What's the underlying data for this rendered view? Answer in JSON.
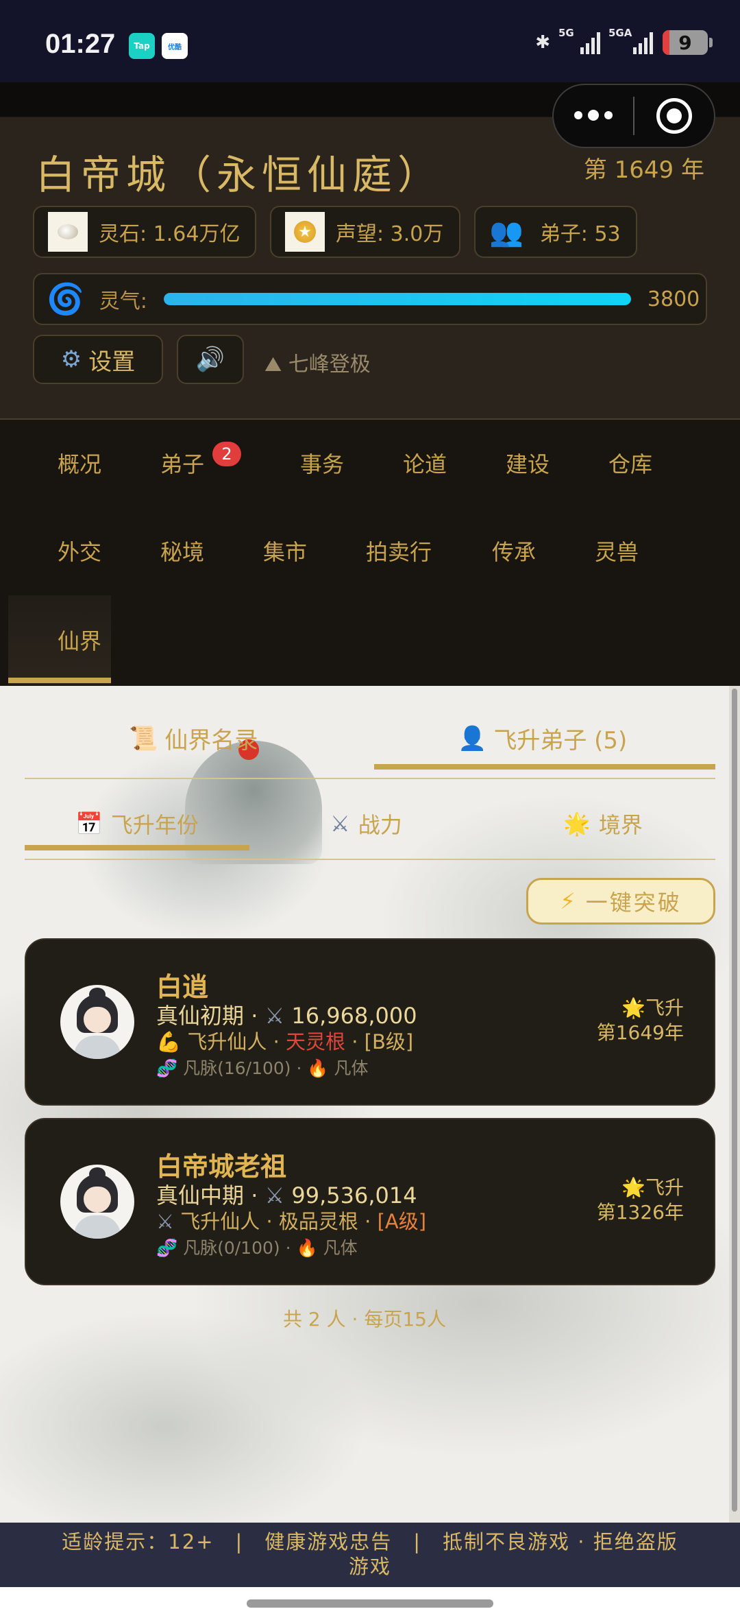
{
  "status_bar": {
    "time": "01:27",
    "apps": [
      "Tap",
      "优酷"
    ],
    "network_1": "5G",
    "network_2": "5GA",
    "battery": "9"
  },
  "header": {
    "sect_title": "白帝城（永恒仙庭）",
    "year": "第 1649 年",
    "spirit_stone": "灵石: 1.64万亿",
    "reputation": "声望: 3.0万",
    "disciples": "弟子: 53",
    "qi_label": "灵气:",
    "qi_value": "3800",
    "qi_fill_fraction": 1.0,
    "settings_label": "设置",
    "settings_icon": "gear-icon",
    "sound_icon": "speaker-icon",
    "peak_text": "七峰登极",
    "peak_icon": "mountain-icon"
  },
  "nav": {
    "items": [
      "概况",
      "弟子",
      "事务",
      "论道",
      "建设",
      "仓库",
      "外交",
      "秘境",
      "集市",
      "拍卖行",
      "传承",
      "灵兽",
      "仙界"
    ],
    "disciple_badge": "2",
    "active": "仙界"
  },
  "tabs": {
    "primary": [
      {
        "label": "仙界名录",
        "icon": "scroll-icon"
      },
      {
        "label": "飞升弟子 (5)",
        "icon": "person-icon",
        "active": true
      }
    ],
    "secondary": [
      {
        "label": "飞升年份",
        "icon": "calendar-icon",
        "active": true
      },
      {
        "label": "战力",
        "icon": "swords-icon"
      },
      {
        "label": "境界",
        "icon": "star-icon"
      }
    ]
  },
  "actions": {
    "breakthrough": "一键突破",
    "breakthrough_icon": "lightning-icon"
  },
  "disciples": [
    {
      "name": "白逍",
      "realm": "真仙初期",
      "power": "16,968,000",
      "trait_icon": "muscle-icon",
      "title": "飞升仙人",
      "root": "天灵根",
      "grade": "[B级]",
      "vein": "凡脉(16/100)",
      "body": "凡体",
      "ascend_label": "飞升",
      "ascend_year": "第1649年"
    },
    {
      "name": "白帝城老祖",
      "realm": "真仙中期",
      "power": "99,536,014",
      "trait_icon": "swords-icon",
      "title": "飞升仙人",
      "root": "极品灵根",
      "grade": "[A级]",
      "vein": "凡脉(0/100)",
      "body": "凡体",
      "ascend_label": "飞升",
      "ascend_year": "第1326年"
    }
  ],
  "pagination": "共 2 人 · 每页15人",
  "notice": {
    "line1": "适龄提示：12+　|　健康游戏忠告　|　抵制不良游戏 · 拒绝盗版",
    "line2": "游戏"
  }
}
